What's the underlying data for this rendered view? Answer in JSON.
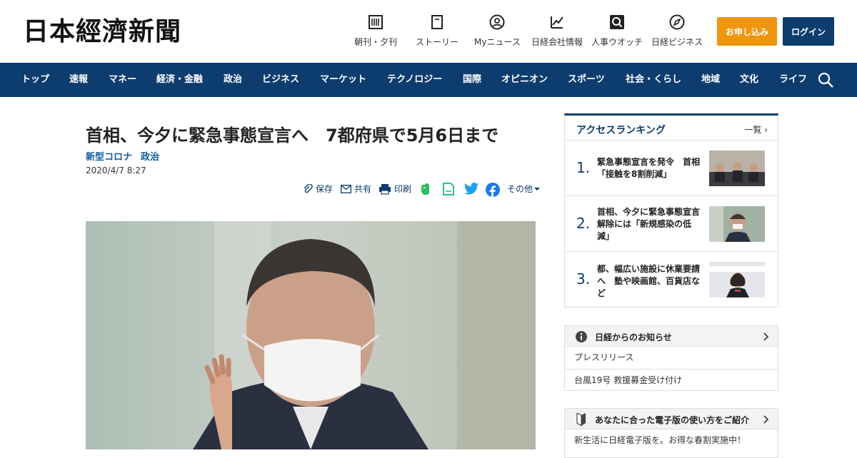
{
  "header": {
    "logo": "日本經濟新聞",
    "utilities": [
      {
        "label": "朝刊・夕刊",
        "icon": "newspaper-icon"
      },
      {
        "label": "ストーリー",
        "icon": "book-icon"
      },
      {
        "label": "Myニュース",
        "icon": "user-icon"
      },
      {
        "label": "日経会社情報",
        "icon": "chart-icon"
      },
      {
        "label": "人事ウオッチ",
        "icon": "magnifier-icon"
      },
      {
        "label": "日経ビジネス",
        "icon": "compass-icon"
      }
    ],
    "subscribe_label": "お申し込み",
    "login_label": "ログイン"
  },
  "nav": {
    "items": [
      "トップ",
      "速報",
      "マネー",
      "経済・金融",
      "政治",
      "ビジネス",
      "マーケット",
      "テクノロジー",
      "国際",
      "オピニオン",
      "スポーツ",
      "社会・くらし",
      "地域",
      "文化",
      "ライフ"
    ]
  },
  "article": {
    "title": "首相、今夕に緊急事態宣言へ　7都府県で5月6日まで",
    "topics": [
      "新型コロナ",
      "政治"
    ],
    "date": "2020/4/7 8:27",
    "share": {
      "save": "保存",
      "share": "共有",
      "print": "印刷",
      "other": "その他"
    }
  },
  "ranking": {
    "title": "アクセスランキング",
    "more": "一覧",
    "items": [
      {
        "rank": "1.",
        "text": "緊急事態宣言を発令　首相「接触を8割削減」"
      },
      {
        "rank": "2.",
        "text": "首相、今夕に緊急事態宣言　解除には「新規感染の低減」"
      },
      {
        "rank": "3.",
        "text": "都、幅広い施設に休業要請へ　塾や映画館、百貨店など"
      }
    ]
  },
  "notices": {
    "title": "日経からのお知らせ",
    "items": [
      "プレスリリース",
      "台風19号 救援募金受け付け"
    ]
  },
  "guide": {
    "title": "あなたに合った電子版の使い方をご紹介",
    "text": "新生活に日経電子版を。お得な春割実施中！"
  },
  "colors": {
    "brand_navy": "#0d3c6e",
    "subscribe_orange": "#f0950e",
    "link_blue": "#0d5a9c"
  }
}
